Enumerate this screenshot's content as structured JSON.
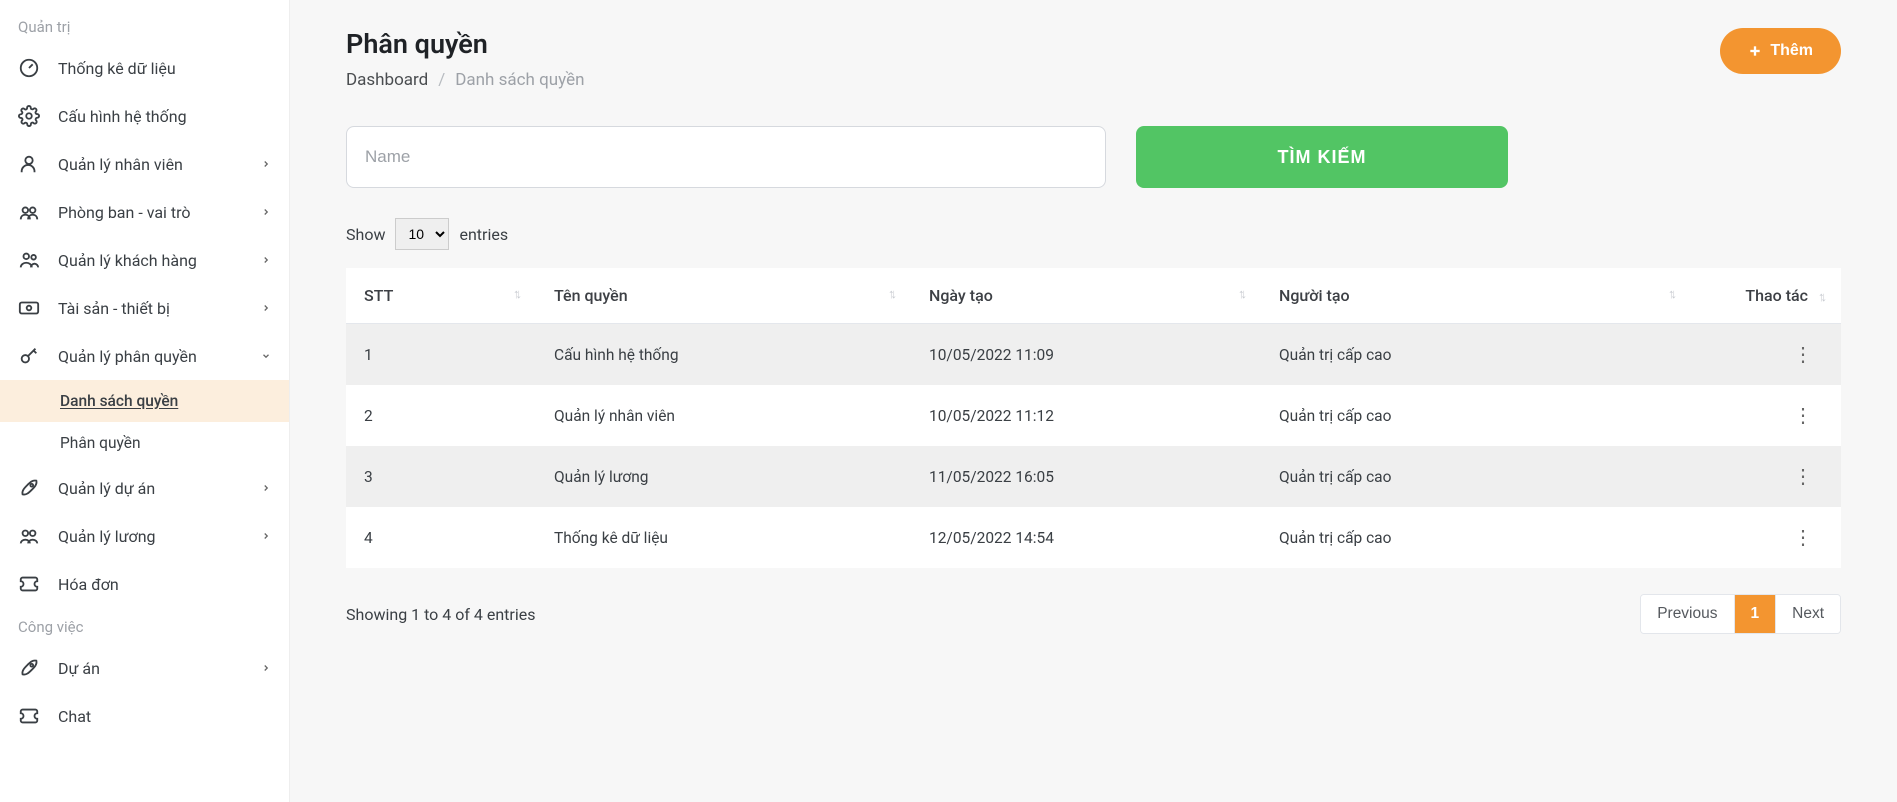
{
  "sidebar": {
    "section_admin": "Quản trị",
    "section_work": "Công việc",
    "items_admin": [
      {
        "label": "Thống kê dữ liệu",
        "has_chev": false,
        "open": false
      },
      {
        "label": "Cấu hình hệ thống",
        "has_chev": false,
        "open": false
      },
      {
        "label": "Quản lý nhân viên",
        "has_chev": true,
        "open": false
      },
      {
        "label": "Phòng ban - vai trò",
        "has_chev": true,
        "open": false
      },
      {
        "label": "Quản lý khách hàng",
        "has_chev": true,
        "open": false
      },
      {
        "label": "Tài sản - thiết bị",
        "has_chev": true,
        "open": false
      },
      {
        "label": "Quản lý phân quyền",
        "has_chev": true,
        "open": true,
        "children": [
          {
            "label": "Danh sách quyền",
            "active": true
          },
          {
            "label": "Phân quyền",
            "active": false
          }
        ]
      },
      {
        "label": "Quản lý dự án",
        "has_chev": true,
        "open": false
      },
      {
        "label": "Quản lý lương",
        "has_chev": true,
        "open": false
      },
      {
        "label": "Hóa đơn",
        "has_chev": false,
        "open": false
      }
    ],
    "items_work": [
      {
        "label": "Dự án",
        "has_chev": true,
        "open": false
      },
      {
        "label": "Chat",
        "has_chev": false,
        "open": false
      }
    ]
  },
  "header": {
    "title": "Phân quyền",
    "crumb_root": "Dashboard",
    "crumb_current": "Danh sách quyền",
    "add_button": "Thêm"
  },
  "search": {
    "placeholder": "Name",
    "button": "TÌM KIẾM"
  },
  "entries": {
    "show": "Show",
    "selected": "10",
    "text": "entries"
  },
  "table": {
    "cols": {
      "stt": "STT",
      "name": "Tên quyền",
      "date": "Ngày tạo",
      "creator": "Người tạo",
      "actions": "Thao tác"
    },
    "rows": [
      {
        "stt": "1",
        "name": "Cấu hình hệ thống",
        "date": "10/05/2022 11:09",
        "creator": "Quản trị cấp cao"
      },
      {
        "stt": "2",
        "name": "Quản lý nhân viên",
        "date": "10/05/2022 11:12",
        "creator": "Quản trị cấp cao"
      },
      {
        "stt": "3",
        "name": "Quản lý lương",
        "date": "11/05/2022 16:05",
        "creator": "Quản trị cấp cao"
      },
      {
        "stt": "4",
        "name": "Thống kê dữ liệu",
        "date": "12/05/2022 14:54",
        "creator": "Quản trị cấp cao"
      }
    ]
  },
  "footer": {
    "info": "Showing 1 to 4 of 4 entries",
    "prev": "Previous",
    "page": "1",
    "next": "Next"
  }
}
